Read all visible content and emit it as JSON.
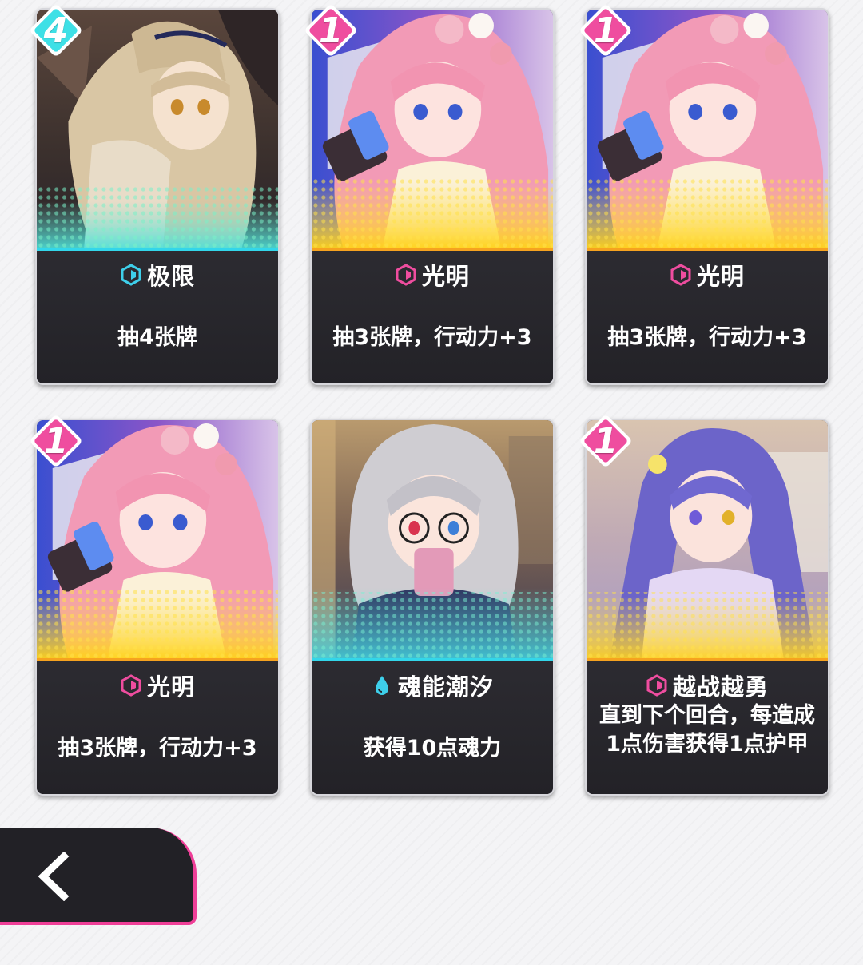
{
  "cards": [
    {
      "cost": "4",
      "cost_color": "#3ee0e6",
      "type_icon": "hexagon-icon",
      "type_color": "#3ecfea",
      "title": "极限",
      "desc": "抽4张牌",
      "stripe": "#33d6ea"
    },
    {
      "cost": "1",
      "cost_color": "#ef4d9f",
      "type_icon": "hexagon-icon",
      "type_color": "#ef4d9f",
      "title": "光明",
      "desc": "抽3张牌，行动力+3",
      "stripe": "#f6a21f"
    },
    {
      "cost": "1",
      "cost_color": "#ef4d9f",
      "type_icon": "hexagon-icon",
      "type_color": "#ef4d9f",
      "title": "光明",
      "desc": "抽3张牌，行动力+3",
      "stripe": "#f6a21f"
    },
    {
      "cost": "1",
      "cost_color": "#ef4d9f",
      "type_icon": "hexagon-icon",
      "type_color": "#ef4d9f",
      "title": "光明",
      "desc": "抽3张牌，行动力+3",
      "stripe": "#f6a21f"
    },
    {
      "cost": "",
      "cost_color": "",
      "type_icon": "water-drop-icon",
      "type_color": "#3ecfea",
      "title": "魂能潮汐",
      "desc": "获得10点魂力",
      "stripe": "#33d6ea"
    },
    {
      "cost": "1",
      "cost_color": "#ef4d9f",
      "type_icon": "hexagon-icon",
      "type_color": "#ef4d9f",
      "title": "越战越勇",
      "desc": "直到下个回合，每造成1点伤害获得1点护甲",
      "stripe": "#f6a21f"
    }
  ],
  "back_button": {
    "icon": "chevron-left-icon",
    "border_color": "#ef3f98"
  }
}
